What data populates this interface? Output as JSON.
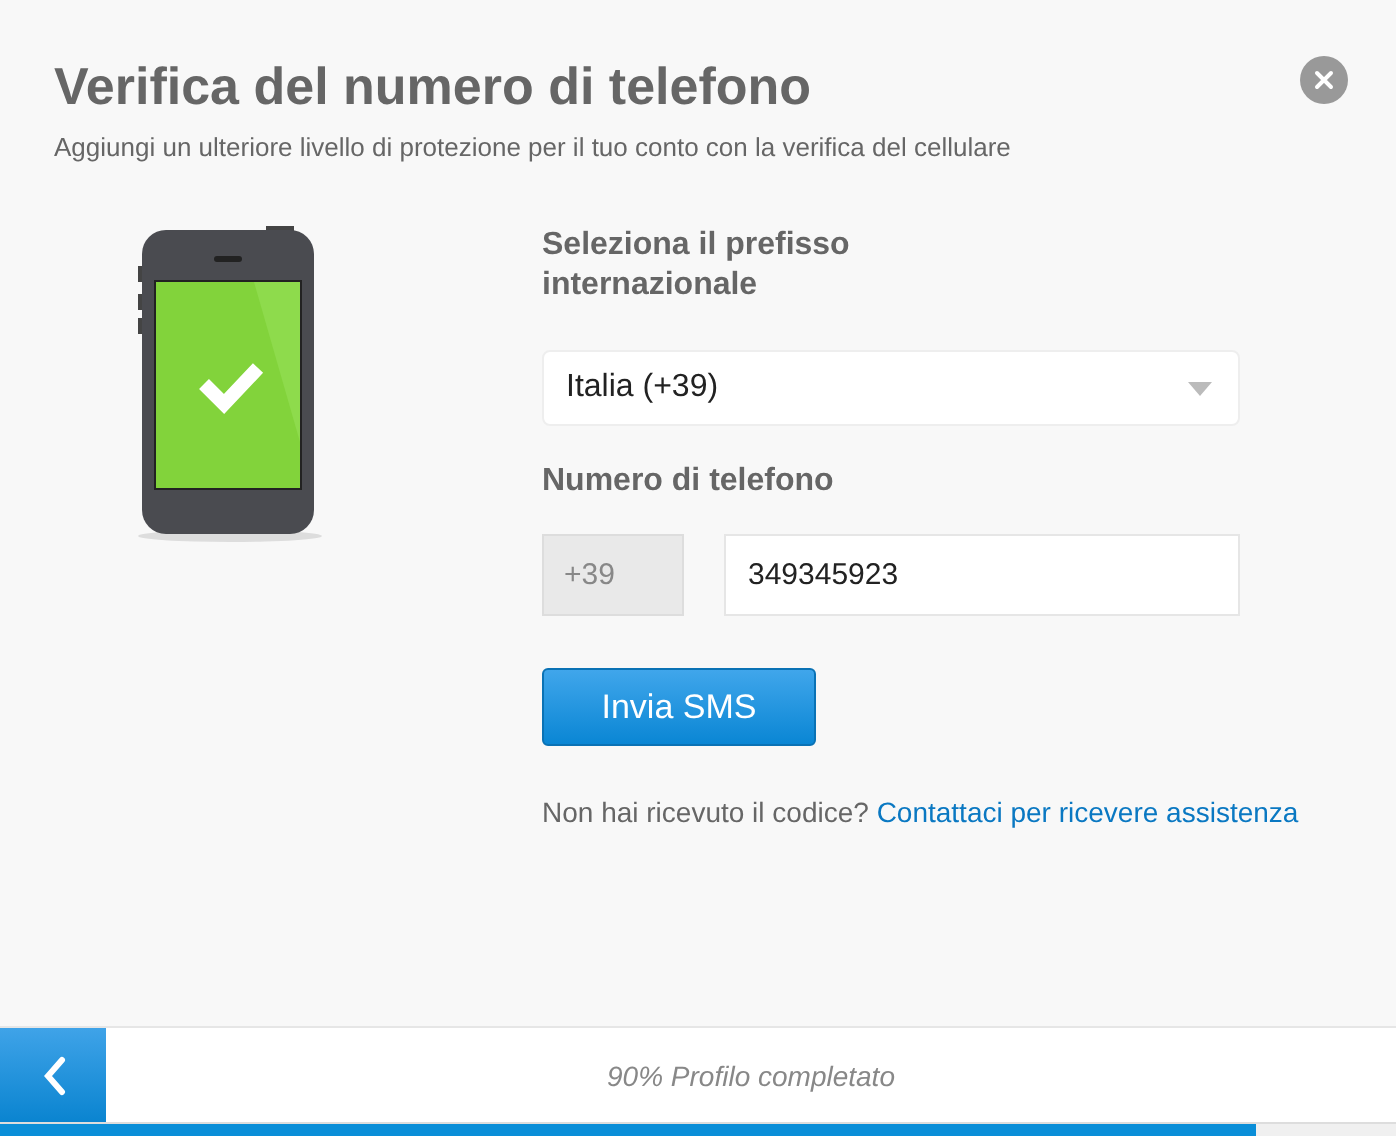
{
  "dialog": {
    "title": "Verifica del numero di telefono",
    "subtitle": "Aggiungi un ulteriore livello di protezione per il tuo conto con la verifica del cellulare"
  },
  "form": {
    "country_label": "Seleziona il prefisso internazionale",
    "country_value": "Italia (+39)",
    "phone_label": "Numero di telefono",
    "prefix": "+39",
    "phone_value": "349345923",
    "submit": "Invia SMS",
    "help_text": "Non hai ricevuto il codice?",
    "help_link": "Contattaci per ricevere assistenza"
  },
  "footer": {
    "progress_text": "90% Profilo completato",
    "level": 0.9
  }
}
